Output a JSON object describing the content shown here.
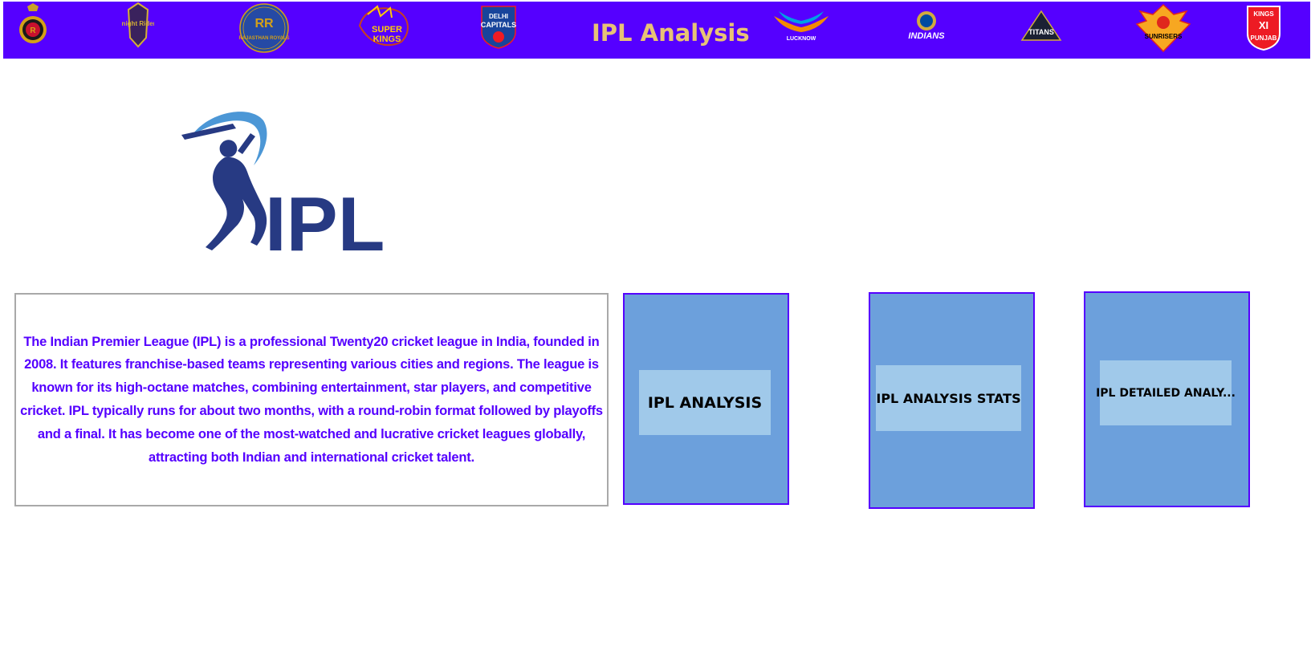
{
  "header": {
    "title": "IPL Analysis",
    "background": "#5500ff",
    "title_color": "#e8c276",
    "team_logos": [
      {
        "name": "rcb-logo"
      },
      {
        "name": "kkr-logo",
        "text": "Knight Riders"
      },
      {
        "name": "rr-logo",
        "text": "RAJASTHAN ROYALS"
      },
      {
        "name": "csk-logo",
        "text": "CHENNAI SUPER KINGS"
      },
      {
        "name": "dc-logo",
        "text": "DELHI CAPITALS"
      },
      {
        "name": "lsg-logo",
        "text": "LUCKNOW SUPER GIANTS"
      },
      {
        "name": "mi-logo",
        "text": "MUMBAI INDIANS"
      },
      {
        "name": "gt-logo",
        "text": "TITANS"
      },
      {
        "name": "srh-logo",
        "text": "SUNRISERS"
      },
      {
        "name": "pbks-logo",
        "text": "KINGS XI PUNJAB"
      }
    ]
  },
  "main_logo": {
    "text": "IPL",
    "color": "#273a83",
    "accent": "#4c97d6"
  },
  "description": {
    "text": "The Indian Premier League (IPL) is a professional Twenty20 cricket league in India, founded in 2008. It features franchise-based teams representing various cities and regions. The league is known for its high-octane matches, combining entertainment, star players, and competitive cricket. IPL typically runs for about two months, with a round-robin format followed by playoffs and a final. It has become one of the most-watched and lucrative cricket leagues globally, attracting both Indian and international cricket talent.",
    "color": "#5500ff"
  },
  "cards": [
    {
      "label": "IPL ANALYSIS"
    },
    {
      "label": "IPL ANALYSIS STATS"
    },
    {
      "label": "IPL DETAILED ANALY..."
    }
  ],
  "colors": {
    "card_bg": "#6ca0dc",
    "button_bg": "#a0c9ea",
    "card_border": "#5500ff"
  }
}
